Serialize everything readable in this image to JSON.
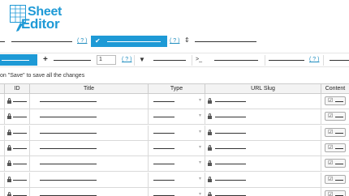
{
  "logo": {
    "line1": "Sheet",
    "line2": "Editor",
    "color": "#1f9ad6"
  },
  "toolbar1": {
    "help_1": "( ? )",
    "help_2": "( ? )",
    "check_glyph": "✔",
    "sort_glyph": "⇕",
    "accent": "#1e9ad6"
  },
  "toolbar2": {
    "plus_glyph": "+",
    "rows_count": "1",
    "help_a": "( ? )",
    "filter_glyph": "▼",
    "terminal_glyph": ">_",
    "help_b": "( ? )"
  },
  "notice": "on \"Save\" to save all the changes",
  "table": {
    "columns": [
      "",
      "ID",
      "Title",
      "Type",
      "URL Slug",
      "Content"
    ],
    "row_count": 7,
    "edit_icon": "☑"
  }
}
